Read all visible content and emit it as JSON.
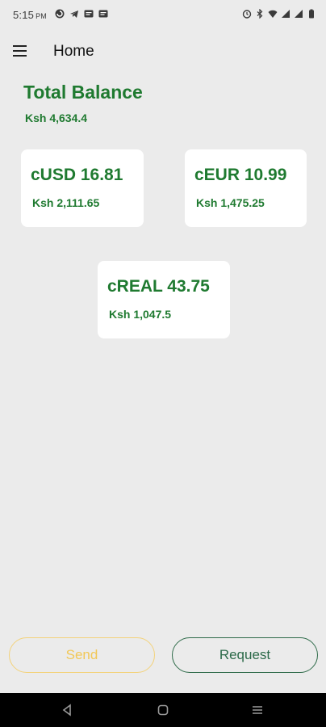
{
  "status_bar": {
    "time": "5:15",
    "ampm": "PM",
    "left_icons": [
      "cloud-sync-icon",
      "telegram-icon",
      "message-icon",
      "message-icon"
    ],
    "right_icons": [
      "alarm-icon",
      "bluetooth-icon",
      "wifi-icon",
      "signal-icon",
      "signal-icon",
      "battery-icon"
    ]
  },
  "app_bar": {
    "title": "Home",
    "menu_icon": "hamburger-menu-icon"
  },
  "balance": {
    "title": "Total Balance",
    "amount_local": "Ksh 4,634.4"
  },
  "cards": [
    {
      "amount": "cUSD 16.81",
      "local": "Ksh 2,111.65"
    },
    {
      "amount": "cEUR 10.99",
      "local": "Ksh 1,475.25"
    },
    {
      "amount": "cREAL 43.75",
      "local": "Ksh 1,047.5"
    }
  ],
  "actions": {
    "send_label": "Send",
    "request_label": "Request"
  },
  "colors": {
    "background": "#ebebeb",
    "accent_green": "#1f7a30",
    "send_yellow": "#f2c857",
    "request_green": "#2c6a49"
  },
  "nav_bar": {
    "icons": [
      "back-icon",
      "home-icon",
      "recents-icon"
    ]
  }
}
